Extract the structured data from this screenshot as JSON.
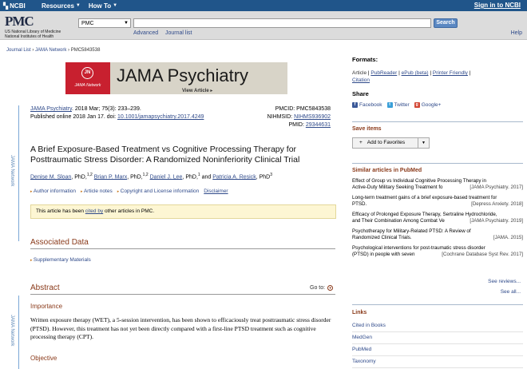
{
  "ncbi_bar": {
    "logo_text": "NCBI",
    "resources": "Resources",
    "how_to": "How To",
    "sign_in": "Sign in to NCBI"
  },
  "search": {
    "logo": "PMC",
    "sub1": "US National Library of Medicine",
    "sub2": "National Institutes of Health",
    "database": "PMC",
    "query": "",
    "button": "Search",
    "advanced": "Advanced",
    "journal_list": "Journal list",
    "help": "Help"
  },
  "breadcrumb": {
    "journal_list": "Journal List",
    "network": "JAMA Network",
    "id": "PMC5843538"
  },
  "banner": {
    "jn_mark": "JN",
    "jn_text": "JAMA Network",
    "title": "JAMA Psychiatry",
    "view_article": "View Article"
  },
  "rail": {
    "label": "JAMA Network"
  },
  "citation": {
    "journal": "JAMA Psychiatry",
    "ref": ". 2018 Mar; 75(3): 233–239.",
    "published": "Published online 2018 Jan 17. doi: ",
    "doi": "10.1001/jamapsychiatry.2017.4249",
    "pmcid_label": "PMCID: PMC5843538",
    "nihmsid_label": "NIHMSID: ",
    "nihmsid": "NIHMS936902",
    "pmid_label": "PMID: ",
    "pmid": "29344631"
  },
  "article": {
    "title": "A Brief Exposure-Based Treatment vs Cognitive Processing Therapy for Posttraumatic Stress Disorder: A Randomized Noninferiority Clinical Trial",
    "authors": [
      {
        "name": "Denise M. Sloan",
        "suffix": ", PhD,",
        "sup": "1,2"
      },
      {
        "name": "Brian P. Marx",
        "suffix": ", PhD,",
        "sup": "1,2"
      },
      {
        "name": "Daniel J. Lee",
        "suffix": ", PhD,",
        "sup": "1"
      },
      {
        "name": "Patricia A. Resick",
        "suffix": ", PhD",
        "sup": "3"
      }
    ],
    "and": " and ",
    "author_info": "Author information",
    "article_notes": "Article notes",
    "copyright": "Copyright and License information",
    "disclaimer": "Disclaimer",
    "cited_pre": "This article has been ",
    "cited_link": "cited by",
    "cited_post": " other articles in PMC."
  },
  "sections": {
    "associated": "Associated Data",
    "supplementary": "Supplementary Materials",
    "abstract": "Abstract",
    "goto": "Go to:",
    "importance": "Importance",
    "importance_text": "Written exposure therapy (WET), a 5-session intervention, has been shown to efficaciously treat posttraumatic stress disorder (PTSD). However, this treatment has not yet been directly compared with a first-line PTSD treatment such as cognitive processing therapy (CPT).",
    "objective": "Objective"
  },
  "sidebar": {
    "formats_head": "Formats:",
    "formats": [
      "Article",
      "PubReader",
      "ePub (beta)",
      "Printer Friendly",
      "Citation"
    ],
    "share_head": "Share",
    "facebook": "Facebook",
    "twitter": "Twitter",
    "google": "Google+",
    "save_head": "Save items",
    "add_fav": "Add to Favorites",
    "similar_head": "Similar articles in PubMed",
    "similar": [
      {
        "l1": "Effect of Group vs Individual Cognitive Processing Therapy in",
        "l2": "Active-Duty Military Seeking Treatment fo",
        "src": "[JAMA Psychiatry. 2017]"
      },
      {
        "l1": "Long-term treatment gains of a brief exposure-based treatment for",
        "l2": "PTSD.",
        "src": "[Depress Anxiety. 2018]"
      },
      {
        "l1": "Efficacy of Prolonged Exposure Therapy, Sertraline Hydrochloride,",
        "l2": "and Their Combination Among Combat Ve",
        "src": "[JAMA Psychiatry. 2019]"
      },
      {
        "l1": "Psychotherapy for Military-Related PTSD: A Review of",
        "l2": "Randomized Clinical Trials.",
        "src": "[JAMA. 2015]"
      },
      {
        "l1": "Psychological interventions for post-traumatic stress disorder",
        "l2": "(PTSD) in people with seven",
        "src": "[Cochrane Database Syst Rev. 2017]"
      }
    ],
    "see_reviews": "See reviews...",
    "see_all": "See all...",
    "links_head": "Links",
    "links": [
      "Cited in Books",
      "MedGen",
      "PubMed",
      "Taxonomy"
    ]
  },
  "colors": {
    "ncbi_blue": "#20558a",
    "section_brown": "#8a3a1a",
    "link": "#2f4a8a",
    "jama_red": "#c8202f"
  }
}
